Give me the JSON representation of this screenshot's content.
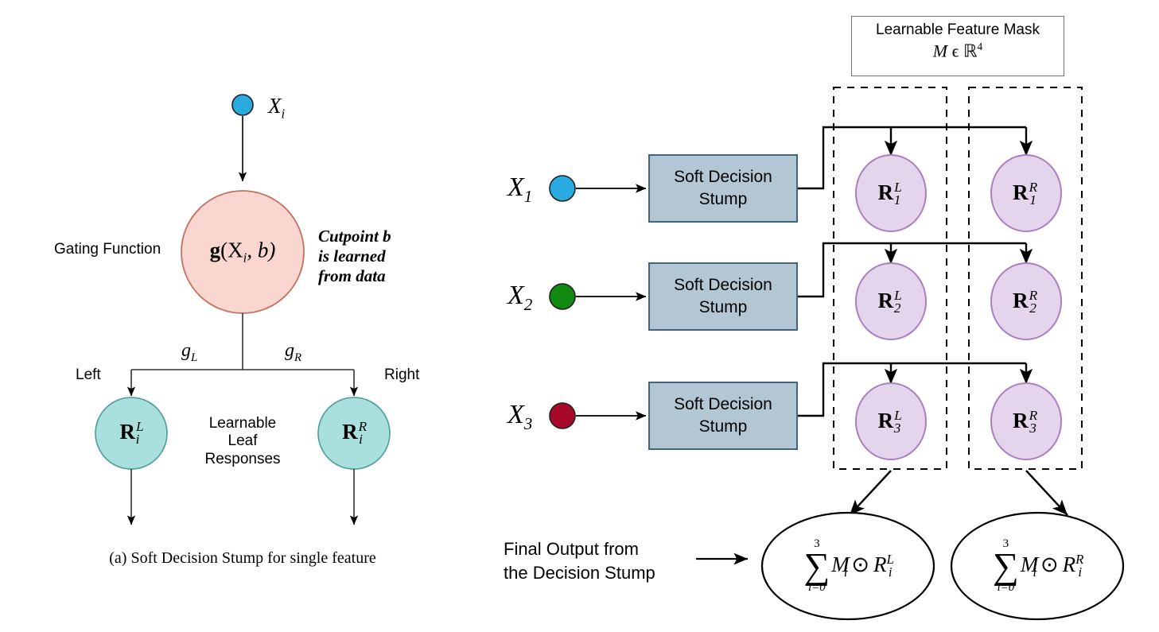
{
  "figure": {
    "caption_a": "(a) Soft Decision Stump for single feature"
  },
  "left_panel": {
    "input_label": "X",
    "input_sub": "i",
    "gating_label_text": "Gating Function",
    "gating_node": {
      "fn": "g",
      "args": "(X",
      "arg_sub": "i",
      "arg_rest": ", b)"
    },
    "cutpoint_note_line1": "Cutpoint b",
    "cutpoint_note_line2": "is learned",
    "cutpoint_note_line3": "from data",
    "edge_left_label": "g",
    "edge_left_sub": "L",
    "edge_right_label": "g",
    "edge_right_sub": "R",
    "left_text": "Left",
    "right_text": "Right",
    "leaf_left": {
      "base": "R",
      "sup": "L",
      "sub": "i"
    },
    "leaf_right": {
      "base": "R",
      "sup": "R",
      "sub": "i"
    },
    "leaf_note_line1": "Learnable",
    "leaf_note_line2": "Leaf",
    "leaf_note_line3": "Responses"
  },
  "right_panel": {
    "mask_box": {
      "title": "Learnable Feature Mask",
      "formula_script": "M",
      "formula_rest": " ϵ ℝ",
      "formula_sup": "4"
    },
    "rows": [
      {
        "input_label": "X",
        "input_sub": "1",
        "dot_color": "#29ABE2",
        "stump_line1": "Soft Decision",
        "stump_line2": "Stump",
        "left_node": {
          "base": "R",
          "sup": "L",
          "sub": "1"
        },
        "right_node": {
          "base": "R",
          "sup": "R",
          "sub": "1"
        }
      },
      {
        "input_label": "X",
        "input_sub": "2",
        "dot_color": "#108A10",
        "stump_line1": "Soft Decision",
        "stump_line2": "Stump",
        "left_node": {
          "base": "R",
          "sup": "L",
          "sub": "2"
        },
        "right_node": {
          "base": "R",
          "sup": "R",
          "sub": "2"
        }
      },
      {
        "input_label": "X",
        "input_sub": "3",
        "dot_color": "#A8082A",
        "stump_line1": "Soft Decision",
        "stump_line2": "Stump",
        "left_node": {
          "base": "R",
          "sup": "L",
          "sub": "3"
        },
        "right_node": {
          "base": "R",
          "sup": "R",
          "sub": "3"
        }
      }
    ],
    "final_output_line1": "Final Output from",
    "final_output_line2": "the Decision Stump",
    "outputs": [
      {
        "sum_upper": "3",
        "sum_lower": "i=0",
        "mask": "M",
        "mask_sub": "i",
        "operator": "⊙",
        "response": "R",
        "response_sup": "L",
        "response_sub": "i"
      },
      {
        "sum_upper": "3",
        "sum_lower": "i=0",
        "mask": "M",
        "mask_sub": "i",
        "operator": "⊙",
        "response": "R",
        "response_sup": "R",
        "response_sub": "i"
      }
    ]
  },
  "colors": {
    "gating_fill": "#F9D7D0",
    "gating_stroke": "#C4705E",
    "leaf_fill": "#A9E0DE",
    "leaf_stroke": "#4C9C9A",
    "response_fill": "#E5D5EC",
    "response_stroke": "#A97FC0",
    "stump_fill": "#B3C6D4",
    "stump_stroke": "#41647A",
    "line": "#000000"
  }
}
